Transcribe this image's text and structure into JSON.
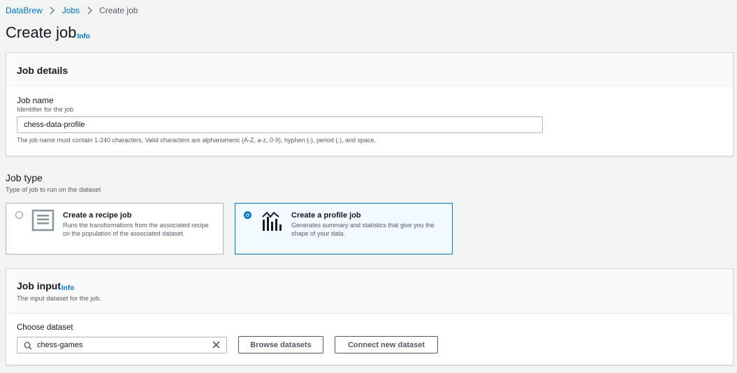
{
  "breadcrumb": {
    "items": [
      "DataBrew",
      "Jobs"
    ],
    "current": "Create job"
  },
  "page": {
    "title": "Create job",
    "info_label": "Info"
  },
  "job_details": {
    "title": "Job details",
    "job_name_label": "Job name",
    "job_name_desc": "Identifier for the job",
    "job_name_value": "chess-data-profile",
    "job_name_constraint": "The job name must contain 1-240 characters. Valid characters are alphanumeric (A-Z, a-z, 0-9), hyphen (-), period (.), and space."
  },
  "job_type": {
    "title": "Job type",
    "desc": "Type of job to run on the dataset",
    "options": [
      {
        "title": "Create a recipe job",
        "desc": "Runs the transformations from the associated recipe on the population of the associated dataset.",
        "icon": "recipe-icon",
        "selected": false
      },
      {
        "title": "Create a profile job",
        "desc": "Generates summary and statistics that give you the shape of your data.",
        "icon": "chart-icon",
        "selected": true
      }
    ]
  },
  "job_input": {
    "title": "Job input",
    "info_label": "Info",
    "desc": "The input dataset for the job.",
    "choose_label": "Choose dataset",
    "dataset_value": "chess-games",
    "browse_button": "Browse datasets",
    "connect_button": "Connect new dataset"
  },
  "colors": {
    "link": "#0073bb",
    "background": "#f2f3f3",
    "selected_tile": "#f1faff"
  }
}
